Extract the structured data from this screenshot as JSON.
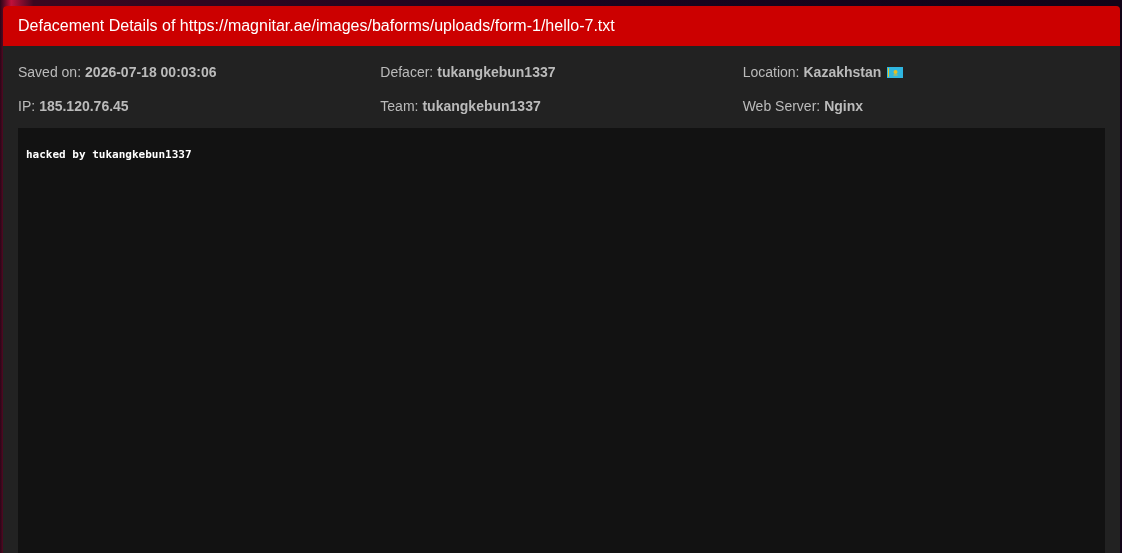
{
  "title": "Defacement Details of https://magnitar.ae/images/baforms/uploads/form-1/hello-7.txt",
  "fields": [
    {
      "label": "Saved on:",
      "value": "2026-07-18 00:03:06",
      "kind": "plain"
    },
    {
      "label": "Defacer:",
      "value": "tukangkebun1337",
      "kind": "plain"
    },
    {
      "label": "Location:",
      "value": "Kazakhstan",
      "kind": "flagged"
    },
    {
      "label": "IP:",
      "value": "185.120.76.45",
      "kind": "plain"
    },
    {
      "label": "Team:",
      "value": "tukangkebun1337",
      "kind": "plain"
    },
    {
      "label": "Web Server:",
      "value": "Nginx",
      "kind": "plain"
    }
  ],
  "mirror_text": "hacked by tukangkebun1337"
}
